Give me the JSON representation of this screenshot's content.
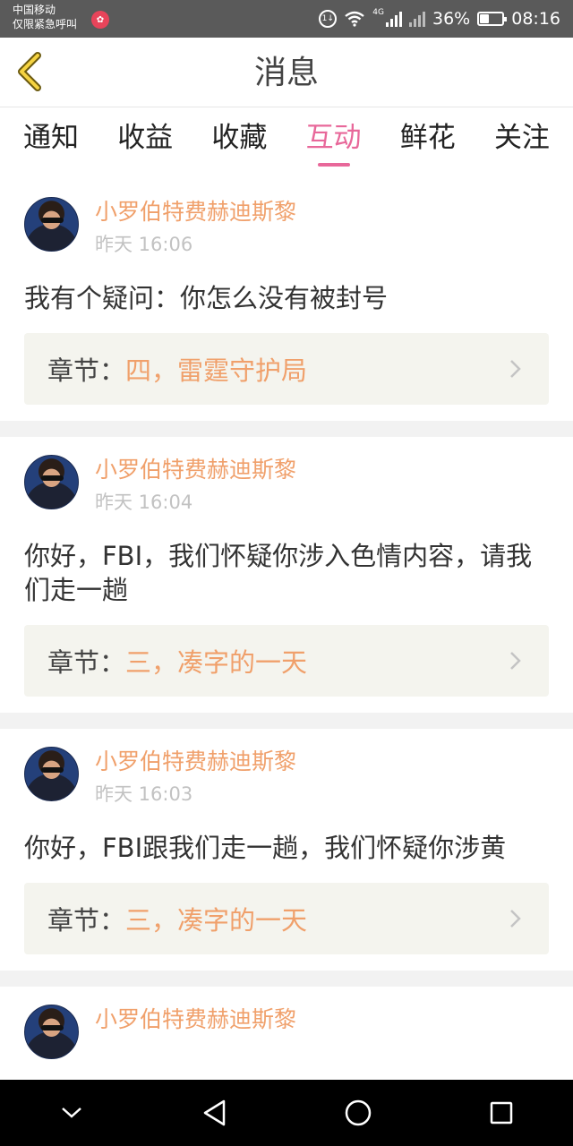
{
  "status_bar": {
    "carrier": "中国移动",
    "emergency": "仅限紧急呼叫",
    "network_type": "4G",
    "battery_percent": "36%",
    "battery_level": 0.36,
    "time": "08:16"
  },
  "header": {
    "title": "消息"
  },
  "tabs": [
    {
      "label": "通知",
      "active": false
    },
    {
      "label": "收益",
      "active": false
    },
    {
      "label": "收藏",
      "active": false
    },
    {
      "label": "互动",
      "active": true
    },
    {
      "label": "鲜花",
      "active": false
    },
    {
      "label": "关注",
      "active": false
    }
  ],
  "messages": [
    {
      "user": "小罗伯特费赫迪斯黎",
      "time": "昨天 16:06",
      "text": "我有个疑问：你怎么没有被封号",
      "chapter_label": "章节：",
      "chapter_title": "四，雷霆守护局"
    },
    {
      "user": "小罗伯特费赫迪斯黎",
      "time": "昨天 16:04",
      "text": "你好，FBI，我们怀疑你涉入色情内容，请我们走一趟",
      "chapter_label": "章节：",
      "chapter_title": "三，凑字的一天"
    },
    {
      "user": "小罗伯特费赫迪斯黎",
      "time": "昨天 16:03",
      "text": "你好，FBI跟我们走一趟，我们怀疑你涉黄",
      "chapter_label": "章节：",
      "chapter_title": "三，凑字的一天"
    },
    {
      "user": "小罗伯特费赫迪斯黎"
    }
  ],
  "colors": {
    "accent_pink": "#e8689a",
    "name_orange": "#f0a06b",
    "status_bar": "#5a5a5a",
    "nav_bar": "#000000"
  },
  "icons": [
    "back-arrow-icon",
    "chevron-right-icon",
    "nav-back-icon",
    "nav-home-icon",
    "nav-recents-icon",
    "nav-collapse-icon"
  ]
}
